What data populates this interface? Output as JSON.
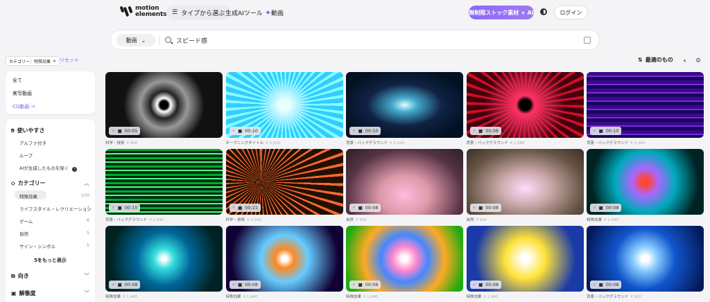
{
  "header": {
    "logo_line1": "motion",
    "logo_line2": "elements",
    "browse_label": "タイプから選ぶ",
    "ai_tools_label": "生成AIツール",
    "video_label": "動画",
    "promo_label": "無制限ストック素材 + AI",
    "login_label": "ログイン"
  },
  "search": {
    "type_label": "動画",
    "value": "スピード感"
  },
  "filters": {
    "chip_label": "カテゴリー：特殊効果",
    "reset_label": "リセット"
  },
  "toolbar": {
    "sort_label": "最適のもの"
  },
  "sidebar": {
    "types": [
      {
        "label": "全て"
      },
      {
        "label": "実写動画"
      },
      {
        "label": "CG動画 →"
      }
    ],
    "usability": {
      "title": "使いやすさ",
      "items": [
        "アルファ付き",
        "ループ",
        "AIが生成したものを除く"
      ]
    },
    "category": {
      "title": "カテゴリー",
      "items": [
        {
          "label": "特殊効果",
          "count": "100"
        },
        {
          "label": "ライフスタイル・レクリエーション",
          "count": "7"
        },
        {
          "label": "ゲーム",
          "count": "6"
        },
        {
          "label": "自然",
          "count": "5"
        },
        {
          "label": "サイン・シンボル",
          "count": "5"
        }
      ],
      "more_label": "5をもっと表示"
    },
    "orientation_title": "向き",
    "resolution_title": "解像度"
  },
  "colors": {
    "accent": "#7b5cf5",
    "background": "#f4f4f7"
  },
  "videos": [
    {
      "duration": "00:05",
      "category": "科学・技術",
      "price": "¥ 900"
    },
    {
      "duration": "00:10",
      "category": "オープニングタイトル",
      "price": "¥ 2,520"
    },
    {
      "duration": "00:10",
      "category": "背景・バックグラウンド",
      "price": "¥ 2,520"
    },
    {
      "duration": "00:08",
      "category": "背景・バックグラウンド",
      "price": "¥ 1,080"
    },
    {
      "duration": "00:10",
      "category": "背景・バックグラウンド",
      "price": "¥ 2,340"
    },
    {
      "duration": "00:10",
      "category": "背景・バックグラウンド",
      "price": "¥ 2,340"
    },
    {
      "duration": "00:21",
      "category": "科学・技術",
      "price": "¥ 2,160"
    },
    {
      "duration": "00:08",
      "category": "自然",
      "price": "¥ 900"
    },
    {
      "duration": "00:08",
      "category": "自然",
      "price": "¥ 900"
    },
    {
      "duration": "00:08",
      "category": "特殊効果",
      "price": "¥ 1,440"
    },
    {
      "duration": "00:08",
      "category": "特殊効果",
      "price": "¥ 1,440"
    },
    {
      "duration": "00:08",
      "category": "特殊効果",
      "price": "¥ 1,440"
    },
    {
      "duration": "00:06",
      "category": "特殊効果",
      "price": "¥ 1,440"
    },
    {
      "duration": "00:08",
      "category": "特殊効果",
      "price": "¥ 1,440"
    },
    {
      "duration": "00:08",
      "category": "背景・バックグラウンド",
      "price": "¥ 900"
    }
  ]
}
